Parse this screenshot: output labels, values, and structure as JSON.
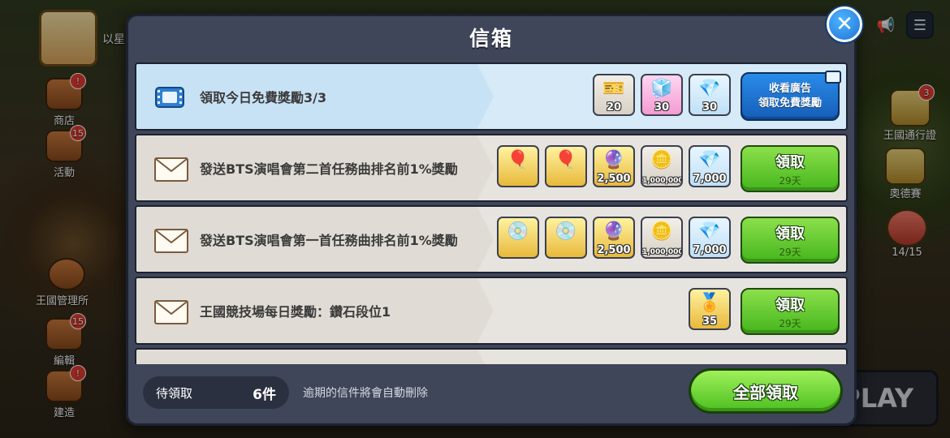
{
  "modal": {
    "title": "信箱",
    "close_glyph": "✕"
  },
  "background": {
    "left_buttons": [
      {
        "label": "商店",
        "badge": "!"
      },
      {
        "label": "活動",
        "badge": "15"
      },
      {
        "label": "王國管理所",
        "badge": ""
      },
      {
        "label": "編輯",
        "badge": "15"
      },
      {
        "label": "建造",
        "badge": "!"
      }
    ],
    "right_buttons": [
      {
        "label": "王國通行證",
        "badge": "3"
      },
      {
        "label": "奧德賽",
        "badge": ""
      },
      {
        "label": "14/15",
        "badge": ""
      }
    ],
    "player_name_fragment": "以星",
    "play_label": "PLAY",
    "top_icons": [
      "megaphone-icon",
      "menu-icon"
    ],
    "menu_glyph": "☰",
    "megaphone_glyph": "📢"
  },
  "ad_row": {
    "title": "領取今日免費獎勵3/3",
    "items": [
      {
        "icon": "cookie-cutter-ticket-icon",
        "qty": "20",
        "glyph": "🎫"
      },
      {
        "icon": "rainbow-cube-icon",
        "qty": "30",
        "glyph": "🧊"
      },
      {
        "icon": "crystal-icon",
        "qty": "30",
        "glyph": "💎"
      }
    ],
    "button_line1": "收看廣告",
    "button_line2": "領取免費獎勵"
  },
  "mails": [
    {
      "title": "發送BTS演唱會第二首任務曲排名前1%獎勵",
      "items": [
        {
          "icon": "profile-balloon-icon",
          "qty": "",
          "glyph": "🎈"
        },
        {
          "icon": "profile-balloon-icon",
          "qty": "",
          "glyph": "🎈"
        },
        {
          "icon": "magic-lamp-icon",
          "qty": "2,500",
          "glyph": "🔮"
        },
        {
          "icon": "coin-icon",
          "qty": "1,000,000",
          "glyph": "🪙"
        },
        {
          "icon": "crystal-icon",
          "qty": "7,000",
          "glyph": "💎"
        }
      ],
      "claim_label": "領取",
      "days_left": "29天"
    },
    {
      "title": "發送BTS演唱會第一首任務曲排名前1%獎勵",
      "items": [
        {
          "icon": "profile-disc-icon",
          "qty": "",
          "glyph": "💿"
        },
        {
          "icon": "profile-disc-icon",
          "qty": "",
          "glyph": "💿"
        },
        {
          "icon": "magic-lamp-icon",
          "qty": "2,500",
          "glyph": "🔮"
        },
        {
          "icon": "coin-icon",
          "qty": "1,000,000",
          "glyph": "🪙"
        },
        {
          "icon": "crystal-icon",
          "qty": "7,000",
          "glyph": "💎"
        }
      ],
      "claim_label": "領取",
      "days_left": "29天"
    },
    {
      "title": "王國競技場每日獎勵：鑽石段位1",
      "items": [
        {
          "icon": "arena-medal-icon",
          "qty": "35",
          "glyph": "🏅"
        }
      ],
      "claim_label": "領取",
      "days_left": "29天"
    }
  ],
  "footer": {
    "pending_label": "待領取",
    "pending_count": "6件",
    "expire_note": "逾期的信件將會自動刪除",
    "claim_all_label": "全部領取"
  },
  "colors": {
    "modal_bg": "#3f4659",
    "claim_green": "#45b51d",
    "ad_blue": "#155eb8",
    "close_blue": "#1e73d6"
  }
}
